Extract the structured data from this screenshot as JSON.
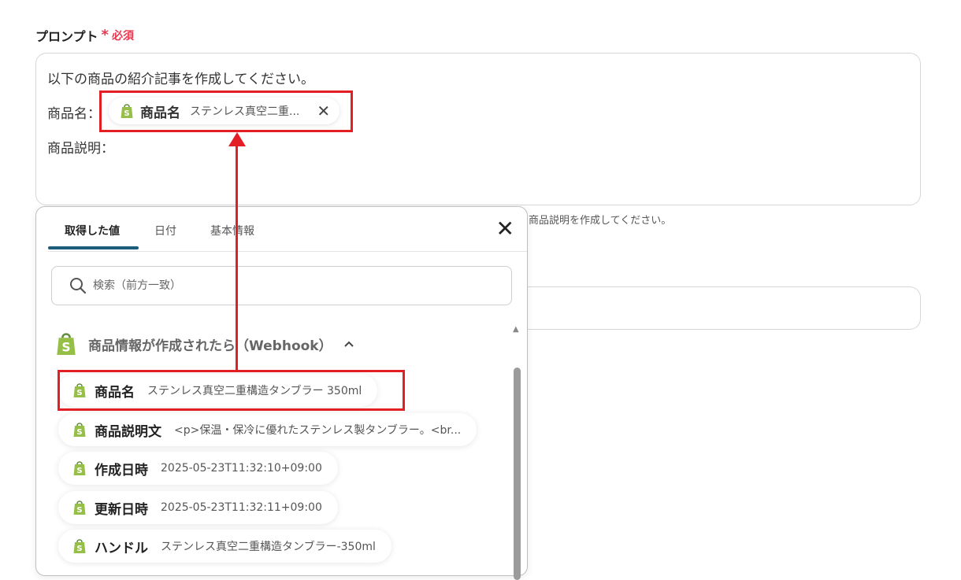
{
  "field": {
    "label": "プロンプト",
    "required_star": "*",
    "required_text": "必須"
  },
  "prompt": {
    "line1": "以下の商品の紹介記事を作成してください。",
    "line2_label": "商品名：",
    "line3_label": "商品説明：",
    "pill": {
      "name": "商品名",
      "value": "ステンレス真空二重...",
      "close": "✕"
    }
  },
  "hint": "商品説明を作成してください。",
  "panel": {
    "tabs": [
      "取得した値",
      "日付",
      "基本情報"
    ],
    "active_tab": 0,
    "close": "✕",
    "search_placeholder": "検索（前方一致）",
    "group_title": "商品情報が作成されたら（Webhook）",
    "items": [
      {
        "name": "商品名",
        "value": "ステンレス真空二重構造タンブラー 350ml"
      },
      {
        "name": "商品説明文",
        "value": "<p>保温・保冷に優れたステンレス製タンブラー。<br..."
      },
      {
        "name": "作成日時",
        "value": "2025-05-23T11:32:10+09:00"
      },
      {
        "name": "更新日時",
        "value": "2025-05-23T11:32:11+09:00"
      },
      {
        "name": "ハンドル",
        "value": "ステンレス真空二重構造タンブラー-350ml"
      }
    ]
  },
  "colors": {
    "accent": "#1b5d7a",
    "highlight": "#e31e24",
    "required": "#e8384f",
    "shopify_green": "#95bf47"
  },
  "icons": {
    "app": "shopify-bag-icon",
    "search": "search-icon",
    "collapse": "chevron-up-icon"
  }
}
